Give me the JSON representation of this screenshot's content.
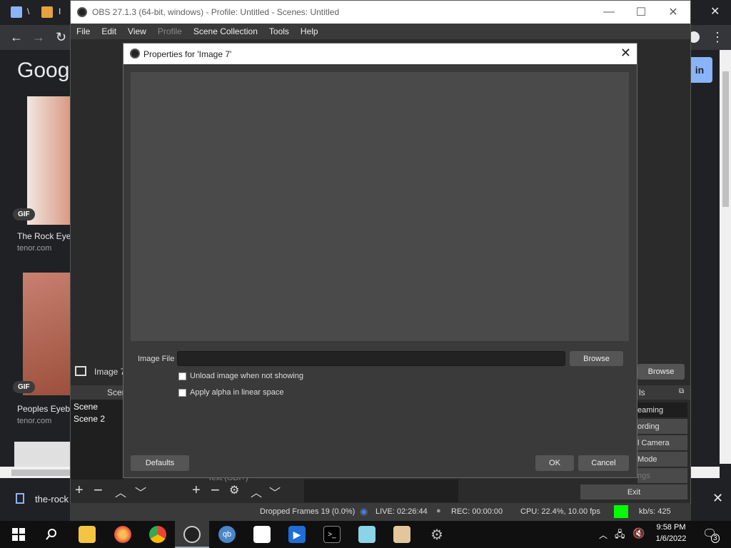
{
  "browser": {
    "google_logo": "Googl",
    "signin_label": "in",
    "results": [
      {
        "title": "The Rock Eye",
        "source": "tenor.com",
        "badge": "GIF"
      },
      {
        "title": "Peoples Eyeb",
        "source": "tenor.com",
        "badge": "GIF"
      }
    ],
    "download_file": "the-rock"
  },
  "obs": {
    "window_title": "OBS 27.1.3 (64-bit, windows) - Profile: Untitled - Scenes: Untitled",
    "menu": [
      "File",
      "Edit",
      "View",
      "Profile",
      "Scene Collection",
      "Tools",
      "Help"
    ],
    "source_bar_label": "Image 7",
    "source_bar_browse": "Browse",
    "scenes_header": "Scen",
    "scenes": [
      "Scene",
      "Scene 2"
    ],
    "controls_header": "ls",
    "controls": [
      "eaming",
      "ording",
      "l Camera",
      "Mode",
      "ngs",
      "Exit"
    ],
    "source_item": "Text (GDI+)",
    "status": {
      "dropped_frames": "Dropped Frames 19 (0.0%)",
      "live": "LIVE: 02:26:44",
      "rec": "REC: 00:00:00",
      "cpu": "CPU: 22.4%, 10.00 fps",
      "kbs": "kb/s: 425",
      "bitrate_color": "#00ff00"
    }
  },
  "dialog": {
    "title": "Properties for 'Image 7'",
    "image_file_label": "Image File",
    "image_file_value": "",
    "browse_label": "Browse",
    "unload_label": "Unload image when not showing",
    "unload_checked": false,
    "alpha_label": "Apply alpha in linear space",
    "alpha_checked": false,
    "defaults_label": "Defaults",
    "ok_label": "OK",
    "cancel_label": "Cancel"
  },
  "taskbar": {
    "time": "9:58 PM",
    "date": "1/6/2022",
    "notification_count": "3"
  }
}
